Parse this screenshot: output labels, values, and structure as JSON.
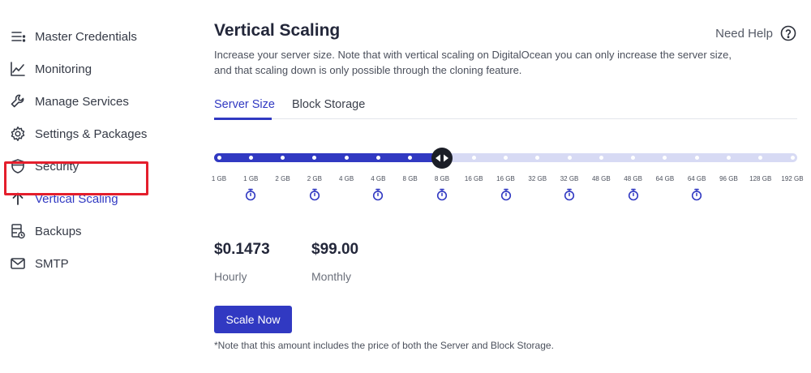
{
  "sidebar": {
    "items": [
      {
        "label": "Master Credentials",
        "icon": "list-icon"
      },
      {
        "label": "Monitoring",
        "icon": "chart-line-icon"
      },
      {
        "label": "Manage Services",
        "icon": "wrench-icon"
      },
      {
        "label": "Settings & Packages",
        "icon": "gear-icon"
      },
      {
        "label": "Security",
        "icon": "shield-icon"
      },
      {
        "label": "Vertical Scaling",
        "icon": "arrow-up-icon",
        "active": true
      },
      {
        "label": "Backups",
        "icon": "backup-icon"
      },
      {
        "label": "SMTP",
        "icon": "mail-icon"
      }
    ]
  },
  "header": {
    "title": "Vertical Scaling",
    "help_label": "Need Help",
    "description": "Increase your server size. Note that with vertical scaling on DigitalOcean you can only increase the server size, and that scaling down is only possible through the cloning feature."
  },
  "tabs": [
    {
      "label": "Server Size",
      "active": true
    },
    {
      "label": "Block Storage",
      "active": false
    }
  ],
  "slider": {
    "stops": [
      "1 GB",
      "1 GB",
      "2 GB",
      "2 GB",
      "4 GB",
      "4 GB",
      "8 GB",
      "8 GB",
      "16 GB",
      "16 GB",
      "32 GB",
      "32 GB",
      "48 GB",
      "48 GB",
      "64 GB",
      "64 GB",
      "96 GB",
      "128 GB",
      "192 GB"
    ],
    "timer_stops": [
      1,
      3,
      5,
      7,
      9,
      11,
      13,
      15
    ],
    "selected_index": 7,
    "colors": {
      "fill": "#3139c2",
      "track": "#d7daf4",
      "knob": "#1b1e27"
    }
  },
  "pricing": {
    "hourly_value": "$0.1473",
    "hourly_label": "Hourly",
    "monthly_value": "$99.00",
    "monthly_label": "Monthly"
  },
  "actions": {
    "scale_label": "Scale Now"
  },
  "note": "*Note that this amount includes the price of both the Server and Block Storage.",
  "colors": {
    "accent": "#3139c2",
    "highlight": "#e41e2c"
  }
}
